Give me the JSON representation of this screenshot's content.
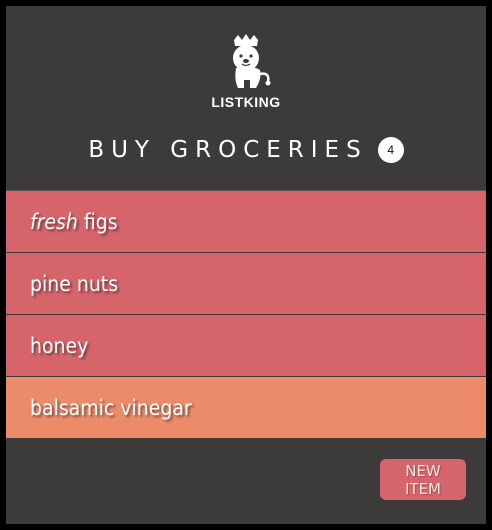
{
  "app": {
    "name": "LISTKING",
    "logo_icon": "crowned-lion-icon"
  },
  "list": {
    "title": "BUY GROCERIES",
    "count": "4",
    "items": [
      {
        "emphasis": "fresh",
        "label": "figs",
        "color": "#d5646b"
      },
      {
        "emphasis": "",
        "label": "pine nuts",
        "color": "#d5646b"
      },
      {
        "emphasis": "",
        "label": "honey",
        "color": "#d5646b"
      },
      {
        "emphasis": "",
        "label": "balsamic vinegar",
        "color": "#ec8b6a"
      }
    ]
  },
  "actions": {
    "new_item_label": "NEW ITEM"
  },
  "colors": {
    "background": "#3d3b3a",
    "item_red": "#d5646b",
    "item_orange": "#ec8b6a",
    "button": "#d5646b"
  }
}
